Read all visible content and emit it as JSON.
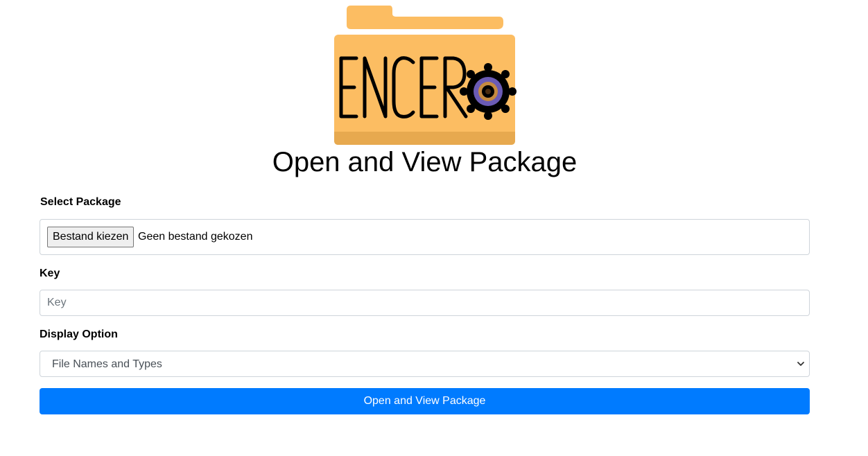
{
  "logo": {
    "text": "ENCERO",
    "icon": "folder-gear-logo",
    "colors": {
      "folder": "#fcbd62",
      "folder_band": "#e7a94f",
      "letters": "#000000",
      "gear": "#000000",
      "ring_outer": "#6b5bb5",
      "ring_inner": "#c68a3f"
    }
  },
  "page_title": "Open and View Package",
  "form": {
    "select_package_label": "Select Package",
    "file_button_label": "Bestand kiezen",
    "file_status": "Geen bestand gekozen",
    "key_label": "Key",
    "key_placeholder": "Key",
    "key_value": "",
    "display_option_label": "Display Option",
    "display_option_selected": "File Names and Types",
    "submit_label": "Open and View Package"
  },
  "colors": {
    "primary": "#007bff",
    "border": "#ced4da"
  }
}
